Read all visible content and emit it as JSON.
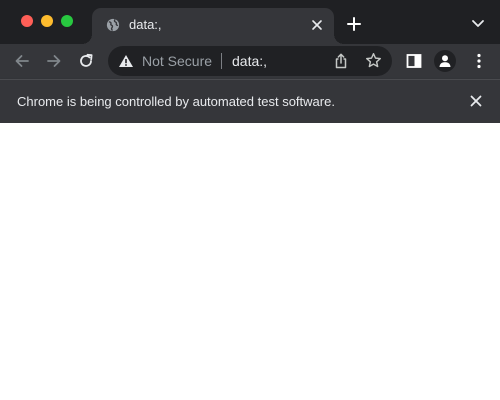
{
  "window": {
    "controls": [
      "close",
      "minimize",
      "zoom"
    ]
  },
  "tab": {
    "title": "data:,",
    "favicon": "globe-icon",
    "close_icon": "close-icon"
  },
  "toolbar": {
    "new_tab_icon": "plus-icon",
    "tab_search_icon": "chevron-down-icon",
    "back_icon": "arrow-left-icon",
    "forward_icon": "arrow-right-icon",
    "reload_icon": "reload-icon",
    "side_panel_icon": "side-panel-icon",
    "profile_icon": "person-icon",
    "menu_icon": "kebab-menu-icon"
  },
  "omnibox": {
    "security_label": "Not Secure",
    "security_icon": "warning-icon",
    "url": "data:,",
    "share_icon": "share-icon",
    "bookmark_icon": "star-icon"
  },
  "infobar": {
    "message": "Chrome is being controlled by automated test software.",
    "close_icon": "close-icon"
  },
  "colors": {
    "tabstrip_bg": "#1f2023",
    "toolbar_bg": "#35363a",
    "omnibox_bg": "#202124",
    "text_primary": "#e8eaed",
    "text_secondary": "#9aa0a6",
    "traffic_red": "#ff5f57",
    "traffic_yellow": "#febc2e",
    "traffic_green": "#28c840",
    "page_bg": "#ffffff"
  }
}
